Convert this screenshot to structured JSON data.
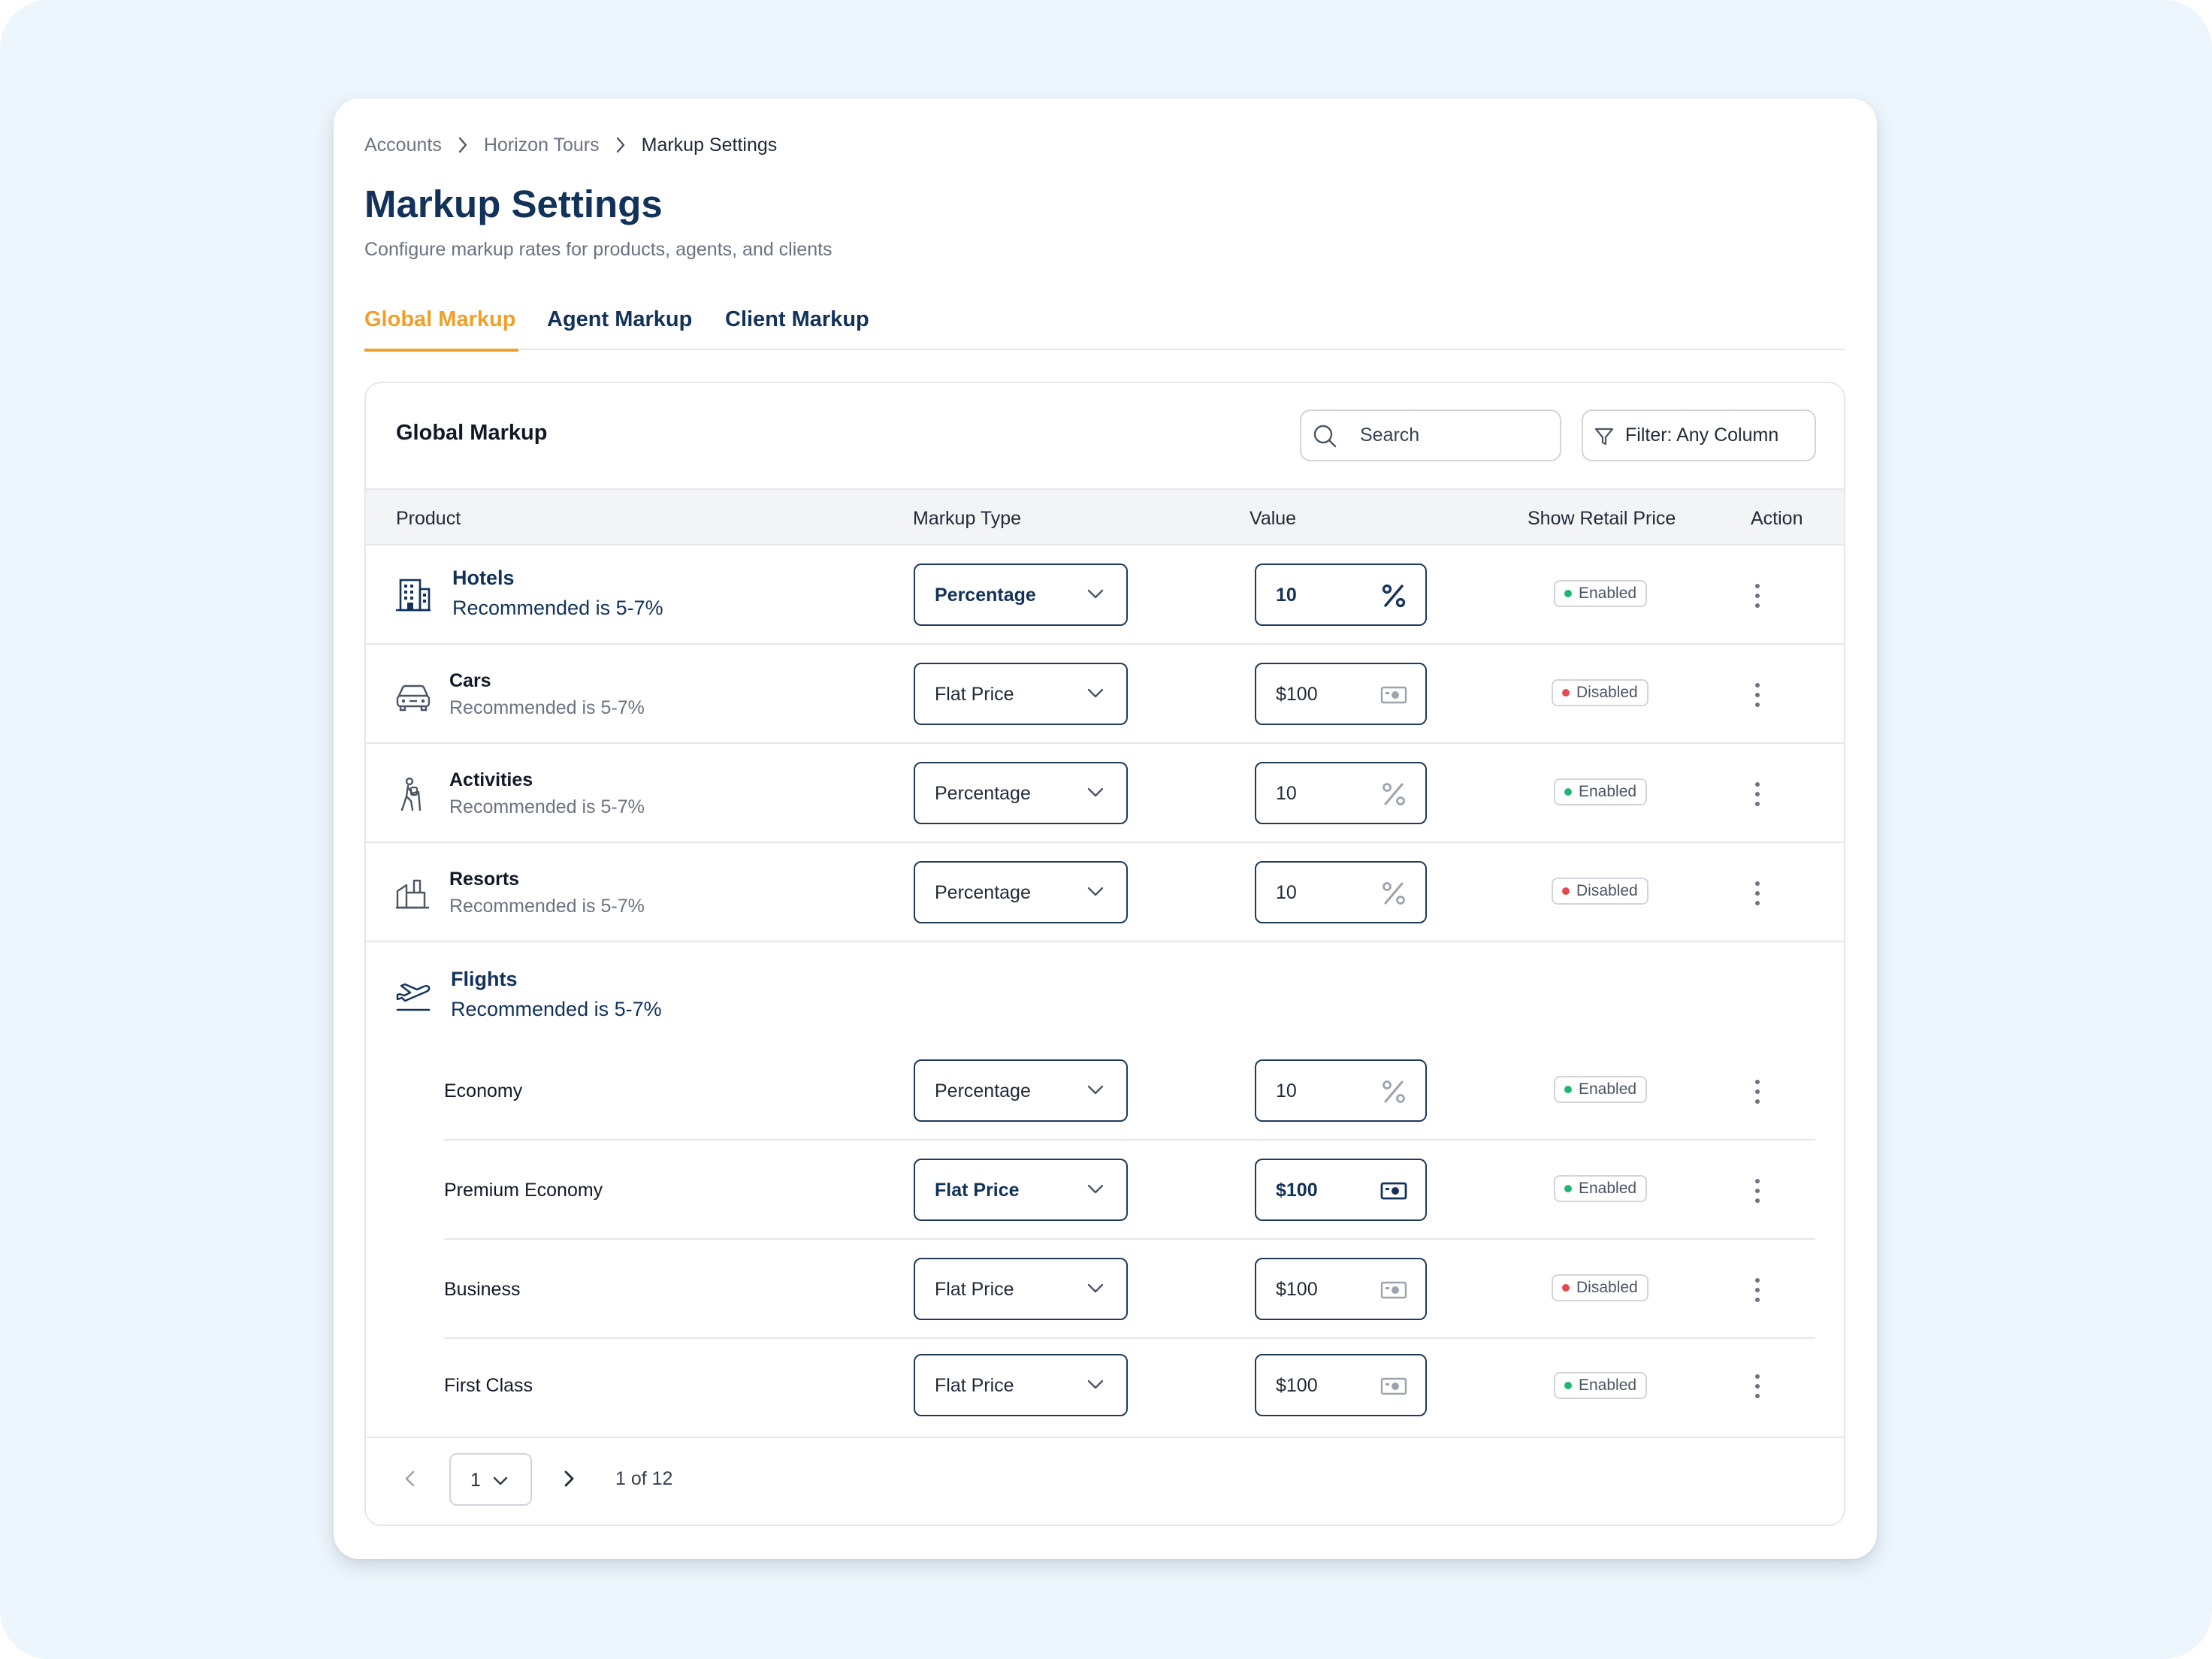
{
  "breadcrumb": {
    "items": [
      "Accounts",
      "Horizon Tours",
      "Markup Settings"
    ]
  },
  "page": {
    "title": "Markup Settings",
    "subtitle": "Configure markup rates for products, agents, and clients"
  },
  "tabs": [
    {
      "label": "Global Markup",
      "active": true
    },
    {
      "label": "Agent Markup",
      "active": false
    },
    {
      "label": "Client Markup",
      "active": false
    }
  ],
  "panel": {
    "title": "Global Markup",
    "search_placeholder": "Search",
    "filter_label": "Filter: Any Column"
  },
  "table": {
    "headers": [
      "Product",
      "Markup Type",
      "Value",
      "Show Retail Price",
      "Action"
    ],
    "rows": [
      {
        "product": "Hotels",
        "note": "Recommended is 5-7%",
        "icon": "hotel-building-icon",
        "markup_type": "Percentage",
        "value": "10",
        "value_icon": "percent-icon",
        "retail": "Enabled"
      },
      {
        "product": "Cars",
        "note": "Recommended is 5-7%",
        "icon": "car-icon",
        "markup_type": "Flat Price",
        "value": "$100",
        "value_icon": "cash-icon",
        "retail": "Disabled"
      },
      {
        "product": "Activities",
        "note": "Recommended is 5-7%",
        "icon": "hiking-icon",
        "markup_type": "Percentage",
        "value": "10",
        "value_icon": "percent-icon",
        "retail": "Enabled"
      },
      {
        "product": "Resorts",
        "note": "Recommended is 5-7%",
        "icon": "resort-icon",
        "markup_type": "Percentage",
        "value": "10",
        "value_icon": "percent-icon",
        "retail": "Disabled"
      }
    ],
    "flights": {
      "product": "Flights",
      "note": "Recommended is 5-7%",
      "icon": "airplane-takeoff-icon",
      "classes": [
        {
          "name": "Economy",
          "markup_type": "Percentage",
          "value": "10",
          "value_icon": "percent-icon",
          "retail": "Enabled"
        },
        {
          "name": "Premium Economy",
          "markup_type": "Flat Price",
          "value": "$100",
          "value_icon": "cash-icon",
          "retail": "Enabled"
        },
        {
          "name": "Business",
          "markup_type": "Flat Price",
          "value": "$100",
          "value_icon": "cash-icon",
          "retail": "Disabled"
        },
        {
          "name": "First Class",
          "markup_type": "Flat Price",
          "value": "$100",
          "value_icon": "cash-icon",
          "retail": "Enabled"
        }
      ]
    }
  },
  "pagination": {
    "page": "1",
    "info": "1 of 12"
  },
  "colors": {
    "accent": "#f0a02a",
    "navy": "#12325a",
    "enabled": "#22b573",
    "disabled": "#e5484d",
    "background": "#eef6fd"
  }
}
